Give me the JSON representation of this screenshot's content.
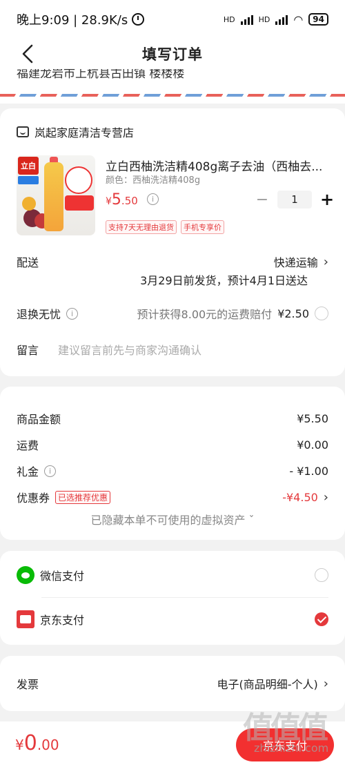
{
  "statusbar": {
    "time_speed": "晚上9:09 | 28.9K/s",
    "battery": "94",
    "hd1": "HD",
    "hd2": "HD"
  },
  "nav": {
    "title": "填写订单"
  },
  "address": {
    "partial_text": "福建龙岩市上杭县古田镇 楼楼楼"
  },
  "shop": {
    "name": "岚起家庭清洁专营店"
  },
  "product": {
    "title": "立白西柚洗洁精408g离子去油（西柚去...",
    "spec": "颜色：西柚洗洁精408g",
    "price_currency": "¥",
    "price_int": "5",
    "price_dec": ".50",
    "quantity": "1",
    "tags": [
      "支持7天无理由退货",
      "手机专享价"
    ],
    "image_logo": "立白"
  },
  "delivery": {
    "label": "配送",
    "method": "快递运输",
    "eta": "3月29日前发货，预计4月1日送达"
  },
  "return_worry_free": {
    "label": "退换无忧",
    "desc": "预计获得8.00元的运费赔付",
    "price": "¥2.50"
  },
  "message": {
    "label": "留言",
    "placeholder": "建议留言前先与商家沟通确认"
  },
  "summary": {
    "goods_label": "商品金额",
    "goods_value": "¥5.50",
    "shipping_label": "运费",
    "shipping_value": "¥0.00",
    "gift_label": "礼金",
    "gift_value": "- ¥1.00",
    "coupon_label": "优惠券",
    "coupon_tag": "已选推荐优惠",
    "coupon_value": "-¥4.50",
    "hidden_assets": "已隐藏本单不可使用的虚拟资产 ˇ"
  },
  "payment": {
    "wechat": "微信支付",
    "jd": "京东支付",
    "selected": "jd"
  },
  "invoice": {
    "label": "发票",
    "value": "电子(商品明细-个人)"
  },
  "bottom": {
    "total_currency": "¥",
    "total_int": "0",
    "total_dec": ".00",
    "pay_button": "京东支付"
  },
  "watermark": {
    "main": "值值值",
    "sub": "zhizhizhi.com"
  },
  "colors": {
    "accent": "#e4393c",
    "wechat": "#09bb07",
    "background": "#f2f2f2"
  }
}
